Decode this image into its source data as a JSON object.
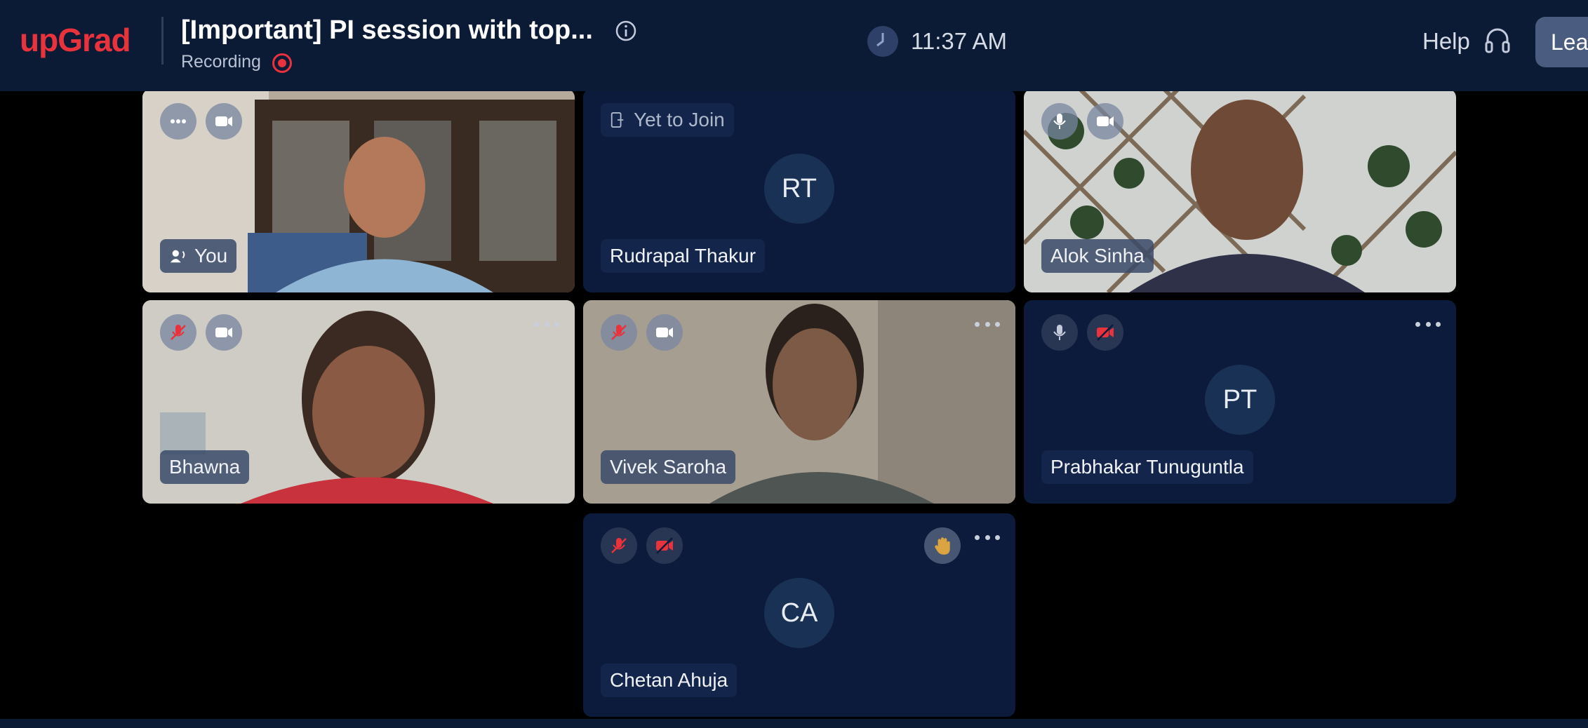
{
  "app": {
    "logo": "upGrad"
  },
  "header": {
    "title": "[Important] PI session with top...",
    "recording_label": "Recording",
    "time": "11:37 AM",
    "help_label": "Help",
    "leave_label": "Lea"
  },
  "tiles": [
    {
      "name": "You",
      "video": true,
      "mic": "speaking",
      "camera": "on"
    },
    {
      "name": "Rudrapal Thakur",
      "status": "Yet to Join",
      "initials": "RT"
    },
    {
      "name": "Alok Sinha",
      "video": true,
      "mic": "on",
      "camera": "on"
    },
    {
      "name": "Bhawna",
      "video": true,
      "mic": "muted",
      "camera": "on"
    },
    {
      "name": "Vivek Saroha",
      "video": true,
      "mic": "muted",
      "camera": "on"
    },
    {
      "name": "Prabhakar Tunuguntla",
      "initials": "PT",
      "mic": "on",
      "camera": "off"
    },
    {
      "name": "Chetan Ahuja",
      "initials": "CA",
      "mic": "muted",
      "camera": "off",
      "hand_raised": true
    }
  ],
  "colors": {
    "brand": "#e8323c",
    "header_bg": "#0b1a35",
    "tile_bg": "#0c1b3c",
    "muted": "#e8323c"
  }
}
